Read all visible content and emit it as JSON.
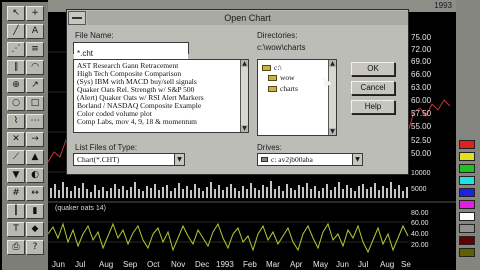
{
  "chart_window": {
    "title_fragment": "1993",
    "price_axis": [
      "75.00",
      "72.00",
      "69.00",
      "66.00",
      "63.00",
      "60.00",
      "57.50",
      "55.00",
      "52.50",
      "50.00"
    ],
    "volume_axis": [
      "10000",
      "5000"
    ],
    "osc_axis": [
      "80.00",
      "60.00",
      "40.00",
      "20.00"
    ],
    "osc_label": "(quaker oats 14)",
    "months": [
      "Jun",
      "Jul",
      "Aug",
      "Sep",
      "Oct",
      "Nov",
      "Dec",
      "1993",
      "Feb",
      "Mar",
      "Apr",
      "May",
      "Jun",
      "Jul",
      "Aug",
      "Se"
    ]
  },
  "dialog": {
    "title": "Open Chart",
    "file_name_label": "File Name:",
    "file_name_value": "*.cht",
    "directories_label": "Directories:",
    "current_dir": "c:\\wow\\charts",
    "files": [
      "AST Research Gann Retracement",
      "High Tech Composite Comparison",
      "(Sys) IBM with MACD buy/sell signals",
      "Quaker Oats Rel. Strength w/ S&P 500",
      "(Alert) Quaker Oats w/ RSI Alert Markers",
      "Borland / NASDAQ Composite Example",
      "Color coded volume plot",
      "Comp Labs, mov 4, 9, 18 & momentum"
    ],
    "dirs": [
      "c:\\",
      "wow",
      "charts"
    ],
    "file_type_label": "List Files of Type:",
    "file_type_value": "Chart(*.CHT)",
    "drives_label": "Drives:",
    "drive_value": "c: av2jb00aba",
    "buttons": {
      "ok": "OK",
      "cancel": "Cancel",
      "help": "Help"
    }
  },
  "colors": {
    "dialog_bg": "#bdbdb7",
    "price_line": "#c43838",
    "volume_bars": "#c8c2c0",
    "osc_line": "#b5c832"
  },
  "palette": [
    "#e02020",
    "#e0e020",
    "#20c020",
    "#20e0e0",
    "#2020e0",
    "#e020e0",
    "#ffffff",
    "#909090",
    "#600000",
    "#606000",
    "#006000",
    "#006060",
    "#000060",
    "#600060"
  ]
}
